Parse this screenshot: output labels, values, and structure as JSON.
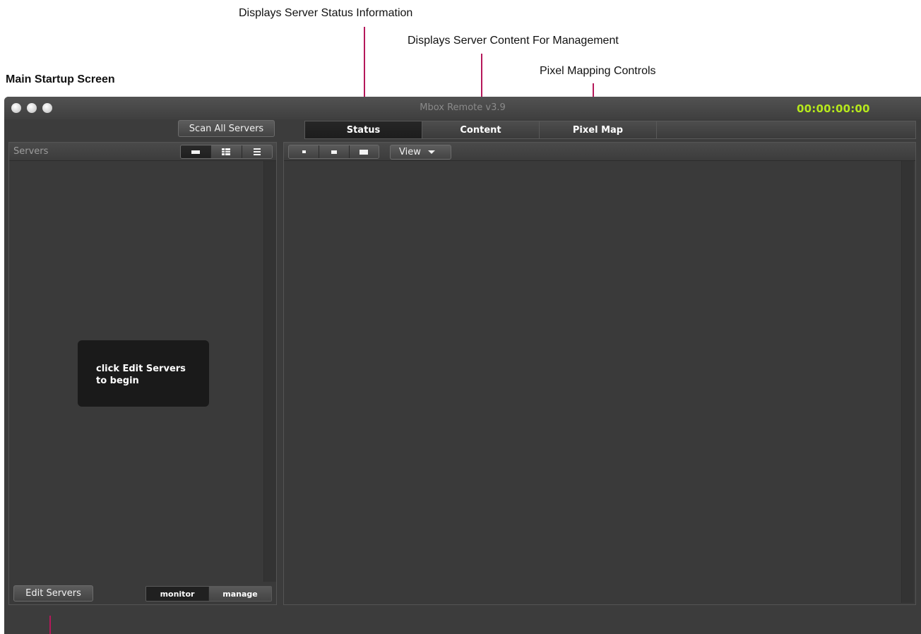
{
  "annotations": {
    "status_note": "Displays Server Status Information",
    "content_note": "Displays Server Content For Management",
    "pixelmap_note": "Pixel Mapping Controls"
  },
  "heading": "Main Startup Screen",
  "window": {
    "title": "Mbox Remote v3.9",
    "timecode": "00:00:00:00",
    "timecode_color": "#b6e81c",
    "traffic_lights": [
      "close",
      "minimize",
      "zoom"
    ]
  },
  "toolbar": {
    "scan_label": "Scan All Servers"
  },
  "tabs": [
    {
      "label": "Status",
      "active": true
    },
    {
      "label": "Content",
      "active": false
    },
    {
      "label": "Pixel Map",
      "active": false
    }
  ],
  "servers_panel": {
    "title": "Servers",
    "view_modes": [
      "large-icon-view",
      "grid-view",
      "list-view"
    ],
    "selected_view": "large-icon-view",
    "hint": "click Edit Servers\nto begin",
    "edit_label": "Edit Servers",
    "mode_options": [
      "monitor",
      "manage"
    ],
    "selected_mode": "monitor"
  },
  "main_panel": {
    "size_options": [
      "small-size",
      "medium-size",
      "large-size"
    ],
    "view_label": "View"
  },
  "colors": {
    "annotation_line": "#b5185a",
    "window_bg": "#3c3c3c"
  }
}
